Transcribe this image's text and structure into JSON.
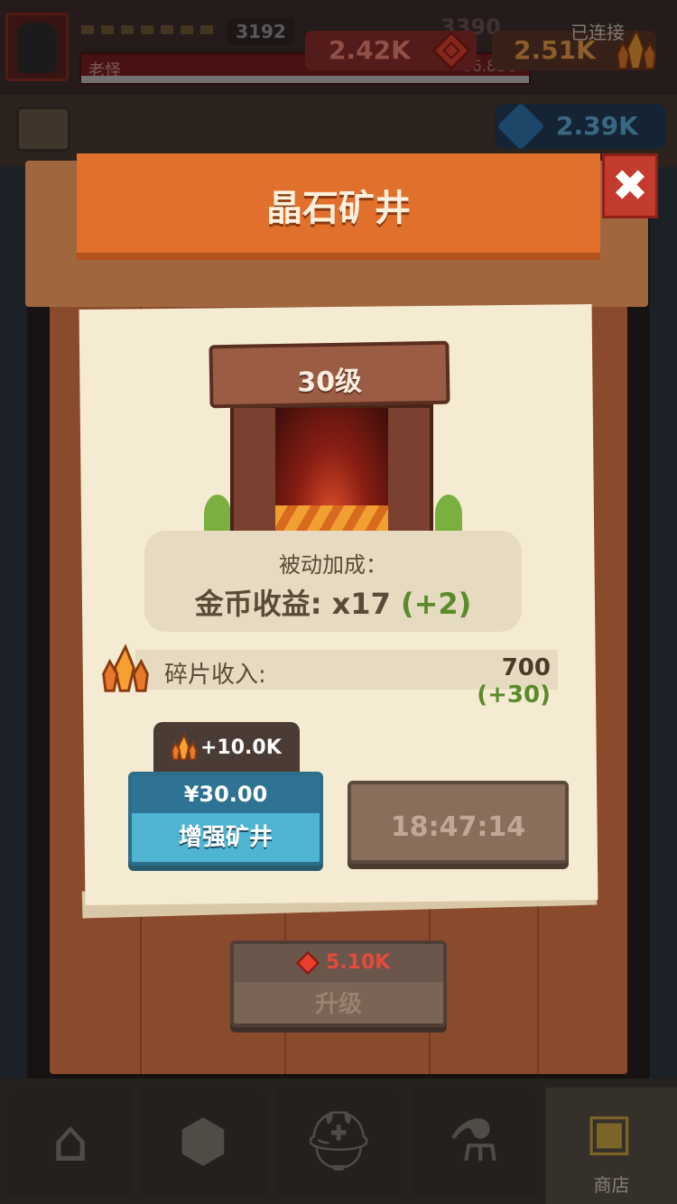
{
  "topbar": {
    "score": "3192",
    "ghost_value": "3390",
    "player_name": "老怪",
    "sub_value": "66.8D3",
    "red_currency": "2.42K",
    "orange_currency": "2.51K",
    "connection_status": "已连接",
    "blue_currency": "2.39K"
  },
  "nav": {
    "shop_label": "商店"
  },
  "modal": {
    "title": "晶石矿井",
    "close_glyph": "✖",
    "level": "30级",
    "bonus_title": "被动加成：",
    "bonus_label": "金币收益:",
    "bonus_value": "x17",
    "bonus_plus": "(+2)",
    "income_label": "碎片收入:",
    "income_value": "700",
    "income_plus": "(+30)",
    "reward": "+10.0K",
    "price": "¥30.00",
    "buy_label": "增强矿井",
    "timer": "18:47:14",
    "upgrade_cost": "5.10K",
    "upgrade_label": "升级"
  },
  "colors": {
    "accent_orange": "#e0702c",
    "close_red": "#c33a2e",
    "buy_blue": "#4fb4d2",
    "bonus_green": "#5a8a2a"
  },
  "icons": {
    "red_gem": "red-gem-icon",
    "crystal": "crystal-icon",
    "blue_gem": "blue-gem-icon",
    "home": "home-icon",
    "gear": "gear-icon",
    "helmet": "helmet-icon",
    "potion": "potion-icon",
    "chest": "chest-icon"
  }
}
